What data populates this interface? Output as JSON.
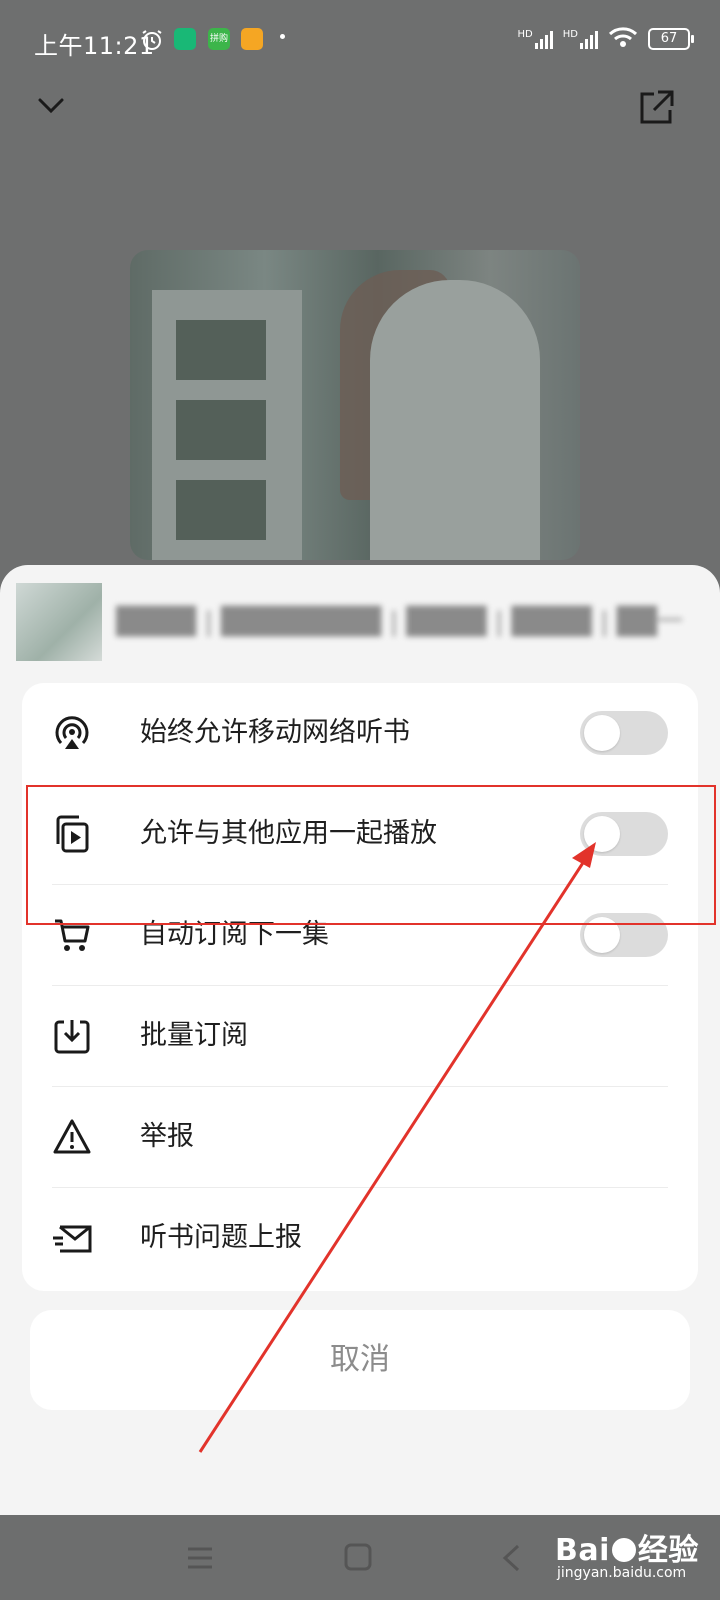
{
  "status_bar": {
    "time": "上午11:21",
    "battery": "67",
    "signal_label_1": "HD",
    "signal_label_2": "HD",
    "app_badge_1": "拼购"
  },
  "book": {
    "title": "████ | ████████ | ████ | ████ | ██一"
  },
  "menu": {
    "items": [
      {
        "label": "始终允许移动网络听书",
        "icon": "broadcast-icon",
        "has_toggle": true,
        "toggle_on": false
      },
      {
        "label": "允许与其他应用一起播放",
        "icon": "multi-play-icon",
        "has_toggle": true,
        "toggle_on": false
      },
      {
        "label": "自动订阅下一集",
        "icon": "cart-icon",
        "has_toggle": true,
        "toggle_on": false
      },
      {
        "label": "批量订阅",
        "icon": "download-tray-icon",
        "has_toggle": false
      },
      {
        "label": "举报",
        "icon": "warning-icon",
        "has_toggle": false
      },
      {
        "label": "听书问题上报",
        "icon": "mail-send-icon",
        "has_toggle": false
      }
    ]
  },
  "cancel_label": "取消",
  "watermark": {
    "brand_a": "Bai",
    "brand_b": "经验",
    "url": "jingyan.baidu.com"
  },
  "colors": {
    "highlight": "#e2332b",
    "toggle_off": "#dcdcdc",
    "sheet_bg": "#f4f4f4"
  }
}
